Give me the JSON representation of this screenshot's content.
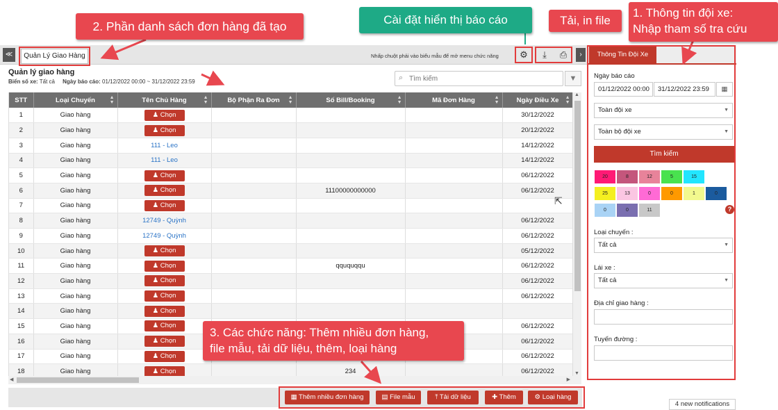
{
  "tabs": {
    "collapse_left": "≪",
    "active_tab": "Quản Lý Giao Hàng",
    "hint": "Nhấp chuột phải vào biểu mẫu để mở menu chức năng",
    "collapse_right": "›"
  },
  "header": {
    "title": "Quản lý giao hàng",
    "vehicle_label": "Biển số xe:",
    "vehicle_value": "Tất cả",
    "date_label": "Ngày báo cáo:",
    "date_value": "01/12/2022 00:00 ~ 31/12/2022 23:59"
  },
  "search": {
    "placeholder": "Tìm kiếm"
  },
  "table": {
    "columns": [
      "STT",
      "Loại Chuyến",
      "Tên Chủ Hàng",
      "Bộ Phận Ra Đơn",
      "Số Bill/Booking",
      "Mã Đơn Hàng",
      "Ngày Điều Xe"
    ],
    "chon_label": "Chọn",
    "rows": [
      {
        "stt": "1",
        "type": "Giao hàng",
        "owner": "",
        "dept": "",
        "bill": "",
        "order": "",
        "date": "30/12/2022"
      },
      {
        "stt": "2",
        "type": "Giao hàng",
        "owner": "",
        "dept": "",
        "bill": "",
        "order": "",
        "date": "20/12/2022"
      },
      {
        "stt": "3",
        "type": "Giao hàng",
        "owner": "111 - Leo",
        "dept": "",
        "bill": "",
        "order": "",
        "date": "14/12/2022"
      },
      {
        "stt": "4",
        "type": "Giao hàng",
        "owner": "111 - Leo",
        "dept": "",
        "bill": "",
        "order": "",
        "date": "14/12/2022"
      },
      {
        "stt": "5",
        "type": "Giao hàng",
        "owner": "",
        "dept": "",
        "bill": "",
        "order": "",
        "date": "06/12/2022"
      },
      {
        "stt": "6",
        "type": "Giao hàng",
        "owner": "",
        "dept": "",
        "bill": "11100000000000",
        "order": "",
        "date": "06/12/2022"
      },
      {
        "stt": "7",
        "type": "Giao hàng",
        "owner": "",
        "dept": "",
        "bill": "",
        "order": "",
        "date": ""
      },
      {
        "stt": "8",
        "type": "Giao hàng",
        "owner": "12749 - Quỳnh",
        "dept": "",
        "bill": "",
        "order": "",
        "date": "06/12/2022"
      },
      {
        "stt": "9",
        "type": "Giao hàng",
        "owner": "12749 - Quỳnh",
        "dept": "",
        "bill": "",
        "order": "",
        "date": "06/12/2022"
      },
      {
        "stt": "10",
        "type": "Giao hàng",
        "owner": "",
        "dept": "",
        "bill": "",
        "order": "",
        "date": "05/12/2022"
      },
      {
        "stt": "11",
        "type": "Giao hàng",
        "owner": "",
        "dept": "",
        "bill": "qququqqu",
        "order": "",
        "date": "06/12/2022"
      },
      {
        "stt": "12",
        "type": "Giao hàng",
        "owner": "",
        "dept": "",
        "bill": "",
        "order": "",
        "date": "06/12/2022"
      },
      {
        "stt": "13",
        "type": "Giao hàng",
        "owner": "",
        "dept": "",
        "bill": "",
        "order": "",
        "date": "06/12/2022"
      },
      {
        "stt": "14",
        "type": "Giao hàng",
        "owner": "",
        "dept": "",
        "bill": "",
        "order": "",
        "date": ""
      },
      {
        "stt": "15",
        "type": "Giao hàng",
        "owner": "",
        "dept": "",
        "bill": "",
        "order": "",
        "date": "06/12/2022"
      },
      {
        "stt": "16",
        "type": "Giao hàng",
        "owner": "",
        "dept": "",
        "bill": "",
        "order": "",
        "date": "06/12/2022"
      },
      {
        "stt": "17",
        "type": "Giao hàng",
        "owner": "",
        "dept": "",
        "bill": "",
        "order": "",
        "date": "06/12/2022"
      },
      {
        "stt": "18",
        "type": "Giao hàng",
        "owner": "",
        "dept": "",
        "bill": "234",
        "order": "",
        "date": "06/12/2022"
      }
    ]
  },
  "actions": {
    "add_many": "Thêm nhiều đơn hàng",
    "template": "File mẫu",
    "upload": "Tải dữ liệu",
    "add": "Thêm",
    "goods_type": "Loại hàng"
  },
  "right_panel": {
    "tab": "Thông Tin Đội Xe",
    "report_date_label": "Ngày báo cáo",
    "date_from": "01/12/2022 00:00",
    "date_to": "31/12/2022 23:59",
    "fleet_select": "Toàn đội xe",
    "team_select": "Toàn bộ đội xe",
    "search_button": "Tìm kiếm",
    "chips": [
      {
        "value": "20",
        "color": "#ff1a75"
      },
      {
        "value": "8",
        "color": "#c4567c"
      },
      {
        "value": "12",
        "color": "#e8839a"
      },
      {
        "value": "5",
        "color": "#49e24f"
      },
      {
        "value": "15",
        "color": "#22e5ff"
      },
      {
        "value": "25",
        "color": "#f4ef20"
      },
      {
        "value": "13",
        "color": "#fbc6e2"
      },
      {
        "value": "0",
        "color": "#ff6ad5"
      },
      {
        "value": "0",
        "color": "#ff9900"
      },
      {
        "value": "1",
        "color": "#f2f98e"
      },
      {
        "value": "0",
        "color": "#1b5b9e"
      },
      {
        "value": "0",
        "color": "#a9d3f5"
      },
      {
        "value": "0",
        "color": "#7a6fb0"
      },
      {
        "value": "11",
        "color": "#c8c8c8"
      }
    ],
    "trip_type_label": "Loại chuyến :",
    "trip_type_value": "Tất cả",
    "driver_label": "Lái xe :",
    "driver_value": "Tất cả",
    "address_label": "Địa chỉ giao hàng :",
    "route_label": "Tuyến đường :"
  },
  "notifications": "4 new notifications",
  "annotations": {
    "list_callout": "2. Phần danh sách đơn hàng đã tạo",
    "settings_callout": "Cài đặt hiển thị báo cáo",
    "download_callout": "Tải, in file",
    "fleet_callout_line1": "1. Thông tin đội xe:",
    "fleet_callout_line2": "Nhập tham số tra cứu",
    "functions_callout_line1": "3. Các chức năng: Thêm nhiều đơn hàng,",
    "functions_callout_line2": "file mẫu, tải dữ liệu, thêm, loại hàng"
  },
  "colors": {
    "accent": "#c0392b",
    "callout_red": "#e8474f",
    "callout_green": "#1eaa86",
    "header_gray": "#6f6f6f"
  }
}
